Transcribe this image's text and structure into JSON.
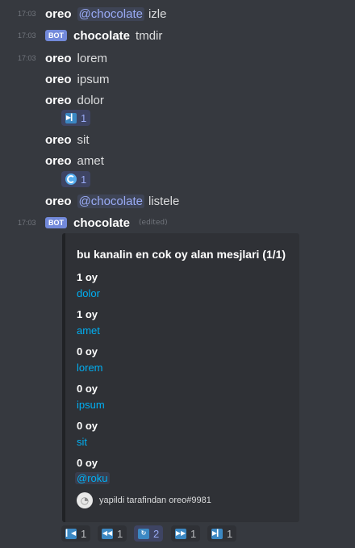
{
  "messages": [
    {
      "time": "17:03",
      "author": "oreo",
      "mention": "@chocolate",
      "text": "izle"
    },
    {
      "time": "17:03",
      "bot_tag": "BOT",
      "author": "chocolate",
      "text": "tmdir"
    },
    {
      "time": "17:03",
      "author": "oreo",
      "text": "lorem"
    },
    {
      "author": "oreo",
      "text": "ipsum"
    },
    {
      "author": "oreo",
      "text": "dolor"
    },
    {
      "author": "oreo",
      "text": "sit"
    },
    {
      "author": "oreo",
      "text": "amet"
    },
    {
      "author": "oreo",
      "mention": "@chocolate",
      "text": "listele"
    },
    {
      "time": "17:03",
      "bot_tag": "BOT",
      "author": "chocolate",
      "edited": "(edited)"
    }
  ],
  "reactions": {
    "dolor": {
      "emoji": "next-track-icon",
      "count": "1"
    },
    "amet": {
      "emoji": "cyclone-icon",
      "count": "1"
    }
  },
  "embed": {
    "title": "bu kanalin en cok oy alan mesjlari (1/1)",
    "fields": [
      {
        "name": "1 oy",
        "value": "dolor"
      },
      {
        "name": "1 oy",
        "value": "amet"
      },
      {
        "name": "0 oy",
        "value": "lorem"
      },
      {
        "name": "0 oy",
        "value": "ipsum"
      },
      {
        "name": "0 oy",
        "value": "sit"
      },
      {
        "name": "0 oy",
        "value": "@roku"
      }
    ],
    "footer": "yapildi tarafindan oreo#9981"
  },
  "pagination": [
    {
      "icon": "first-page-icon",
      "count": "1"
    },
    {
      "icon": "previous-page-icon",
      "count": "1"
    },
    {
      "icon": "refresh-icon",
      "count": "2",
      "active": true
    },
    {
      "icon": "next-page-icon",
      "count": "1"
    },
    {
      "icon": "last-page-icon",
      "count": "1"
    }
  ],
  "colors": {
    "background": "#36393f",
    "embed": "#2f3136",
    "link": "#00b0f4",
    "mention": "#99aaf5",
    "bot_tag": "#7289da"
  }
}
